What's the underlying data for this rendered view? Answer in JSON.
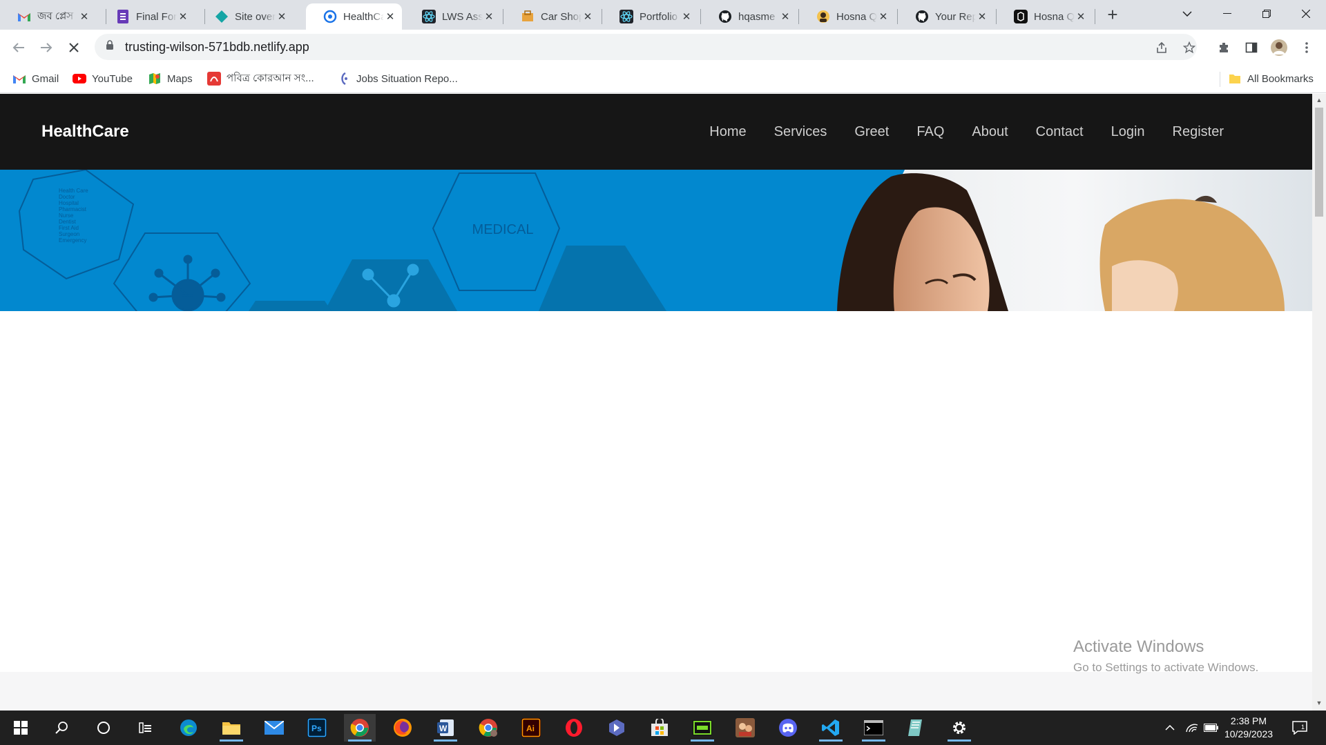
{
  "browser": {
    "tabs": [
      {
        "title": "জব প্লেস",
        "icon": "gmail-icon"
      },
      {
        "title": "Final For",
        "icon": "forms-icon"
      },
      {
        "title": "Site over",
        "icon": "netlify-icon"
      },
      {
        "title": "HealthCa",
        "icon": "site-icon",
        "active": true
      },
      {
        "title": "LWS Ass",
        "icon": "react-icon"
      },
      {
        "title": "Car Shop",
        "icon": "shop-icon"
      },
      {
        "title": "Portfolio",
        "icon": "react-icon"
      },
      {
        "title": "hqasme",
        "icon": "github-icon"
      },
      {
        "title": "Hosna Q",
        "icon": "profile-icon"
      },
      {
        "title": "Your Rep",
        "icon": "github-icon"
      },
      {
        "title": "Hosna Q",
        "icon": "codesandbox-icon"
      }
    ],
    "url": "trusting-wilson-571bdb.netlify.app",
    "bookmarks": [
      {
        "label": "Gmail",
        "icon": "gmail-icon"
      },
      {
        "label": "YouTube",
        "icon": "youtube-icon"
      },
      {
        "label": "Maps",
        "icon": "maps-icon"
      },
      {
        "label": "পবিত্র কোরআন সং...",
        "icon": "quran-icon"
      },
      {
        "label": "Jobs Situation Repo...",
        "icon": "jobs-icon"
      }
    ],
    "all_bookmarks": "All Bookmarks"
  },
  "site": {
    "brand": "HealthCare",
    "menu": [
      "Home",
      "Services",
      "Greet",
      "FAQ",
      "About",
      "Contact",
      "Login",
      "Register"
    ],
    "hero": {
      "medical_text": "MEDICAL",
      "hex_list": [
        "Health Care",
        "Doctor",
        "Hospital",
        "Pharmacist",
        "Nurse",
        "Dentist",
        "First Aid",
        "Surgeon",
        "Emergency"
      ]
    }
  },
  "watermark": {
    "title": "Activate Windows",
    "subtitle": "Go to Settings to activate Windows."
  },
  "taskbar": {
    "time": "2:38 PM",
    "date": "10/29/2023"
  },
  "colors": {
    "navbar_bg": "#161616",
    "hero_blue": "#0288cf",
    "taskbar_bg": "#202020"
  }
}
